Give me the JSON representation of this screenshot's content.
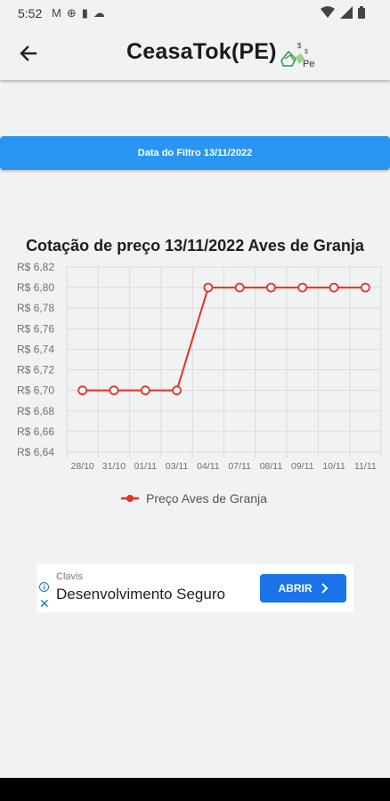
{
  "status": {
    "time": "5:52"
  },
  "app": {
    "title": "CeasaTok(PE)",
    "logo_text": "Pe"
  },
  "filter": {
    "label": "Data do Filtro 13/11/2022"
  },
  "chart_data": {
    "type": "line",
    "title": "Cotação de preço 13/11/2022 Aves de Granja",
    "categories": [
      "28/10",
      "31/10",
      "01/11",
      "03/11",
      "04/11",
      "07/11",
      "08/11",
      "09/11",
      "10/11",
      "11/11"
    ],
    "series": [
      {
        "name": "Preço Aves de Granja",
        "values": [
          6.7,
          6.7,
          6.7,
          6.7,
          6.8,
          6.8,
          6.8,
          6.8,
          6.8,
          6.8
        ],
        "color": "#e8301f"
      }
    ],
    "yticks": [
      "R$ 6,82",
      "R$ 6,80",
      "R$ 6,78",
      "R$ 6,76",
      "R$ 6,74",
      "R$ 6,72",
      "R$ 6,70",
      "R$ 6,68",
      "R$ 6,66",
      "R$ 6,64"
    ],
    "ylim": [
      6.64,
      6.82
    ],
    "grid": true,
    "legend": "bottom"
  },
  "ad": {
    "brand": "Clavis",
    "title": "Desenvolvimento Seguro",
    "button": "ABRIR",
    "close": "✕"
  }
}
